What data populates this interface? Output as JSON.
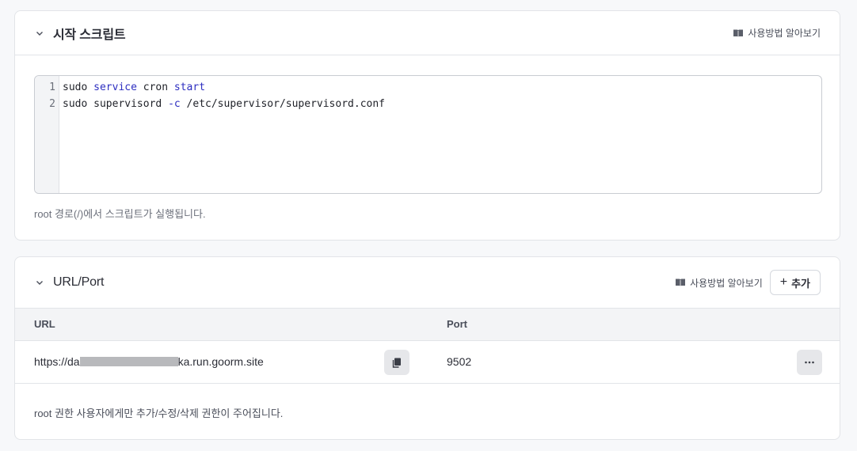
{
  "script_section": {
    "title": "시작 스크립트",
    "guide_label": "사용방법 알아보기",
    "lines": [
      {
        "num": "1",
        "parts": [
          {
            "t": "sudo ",
            "k": false
          },
          {
            "t": "service",
            "k": true
          },
          {
            "t": " cron ",
            "k": false
          },
          {
            "t": "start",
            "k": true
          }
        ]
      },
      {
        "num": "2",
        "parts": [
          {
            "t": "sudo supervisord ",
            "k": false
          },
          {
            "t": "-c",
            "k": true
          },
          {
            "t": " /etc/supervisor/supervisord.conf",
            "k": false
          }
        ]
      }
    ],
    "hint": "root 경로(/)에서 스크립트가 실행됩니다."
  },
  "url_section": {
    "title": "URL/Port",
    "guide_label": "사용방법 알아보기",
    "add_label": "추가",
    "columns": {
      "url": "URL",
      "port": "Port"
    },
    "rows": [
      {
        "url_prefix": "https://da",
        "url_suffix": "ka.run.goorm.site",
        "port": "9502"
      }
    ],
    "note": "root 권한 사용자에게만 추가/수정/삭제 권한이 주어집니다."
  },
  "colors": {
    "keyword": "#2d2ec0",
    "border": "#e2e4e8",
    "muted": "#6b6f7a"
  }
}
